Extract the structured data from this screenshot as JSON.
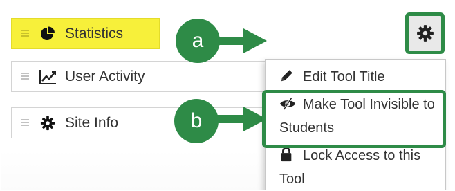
{
  "tools": [
    {
      "label": "Statistics",
      "icon": "pie-chart-icon"
    },
    {
      "label": "User Activity",
      "icon": "line-chart-icon"
    },
    {
      "label": "Site Info",
      "icon": "gear-icon"
    }
  ],
  "settings_button": {
    "icon": "gear-icon"
  },
  "menu": {
    "edit_title": "Edit Tool Title",
    "make_invisible": "Make Tool Invisible to Students",
    "lock_access": "Lock Access to this Tool"
  },
  "callouts": {
    "step_a": "a",
    "step_b": "b"
  },
  "colors": {
    "highlight": "#f7f03a",
    "callout_green": "#2e8b47"
  }
}
